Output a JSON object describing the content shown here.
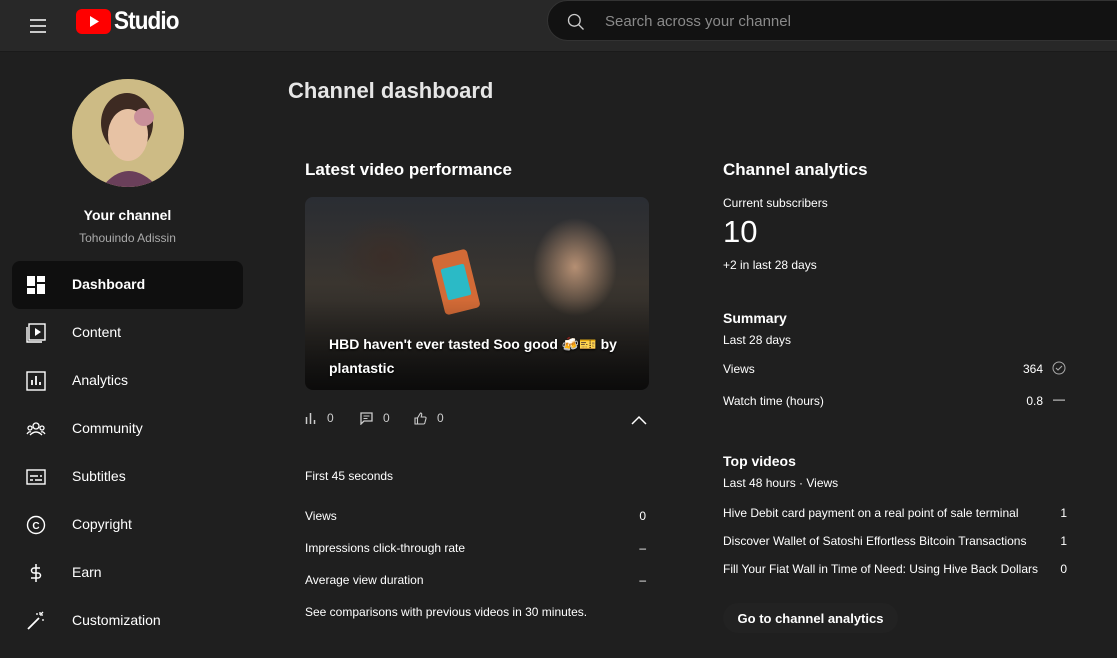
{
  "header": {
    "logo_text": "Studio",
    "search_placeholder": "Search across your channel"
  },
  "sidebar": {
    "channel_title": "Your channel",
    "channel_handle": "Tohouindo Adissin",
    "items": [
      {
        "label": "Dashboard",
        "icon": "dashboard-icon",
        "active": true
      },
      {
        "label": "Content",
        "icon": "content-icon"
      },
      {
        "label": "Analytics",
        "icon": "analytics-icon"
      },
      {
        "label": "Community",
        "icon": "community-icon"
      },
      {
        "label": "Subtitles",
        "icon": "subtitles-icon"
      },
      {
        "label": "Copyright",
        "icon": "copyright-icon"
      },
      {
        "label": "Earn",
        "icon": "earn-icon"
      },
      {
        "label": "Customization",
        "icon": "customization-icon"
      }
    ]
  },
  "main": {
    "page_title": "Channel dashboard",
    "latest": {
      "title": "Latest video performance",
      "video_title": "HBD haven't ever tasted Soo good 🍻🎫 by plantastic",
      "views_count": "0",
      "comments_count": "0",
      "likes_count": "0",
      "period": "First 45 seconds",
      "rows": [
        {
          "label": "Views",
          "value": "0"
        },
        {
          "label": "Impressions click-through rate",
          "value": "–"
        },
        {
          "label": "Average view duration",
          "value": "–"
        }
      ],
      "footnote": "See comparisons with previous videos in 30 minutes."
    },
    "analytics": {
      "title": "Channel analytics",
      "subscribers_label": "Current subscribers",
      "subscribers_value": "10",
      "subscribers_delta": "+2 in last 28 days",
      "summary_title": "Summary",
      "summary_period": "Last 28 days",
      "summary_rows": [
        {
          "label": "Views",
          "value": "364",
          "indicator": "✓"
        },
        {
          "label": "Watch time (hours)",
          "value": "0.8",
          "indicator": "—"
        }
      ],
      "top_title": "Top videos",
      "top_period": "Last 48 hours · Views",
      "top_videos": [
        {
          "title": "Hive Debit card payment on a real point of sale terminal",
          "views": "1"
        },
        {
          "title": "Discover Wallet of Satoshi Effortless Bitcoin Transactions",
          "views": "1"
        },
        {
          "title": "Fill Your Fiat Wall in Time of Need: Using Hive Back Dollars",
          "views": "0"
        }
      ],
      "button_label": "Go to channel analytics"
    }
  },
  "colors": {
    "page_bg": "#1f1f1f",
    "header_bg": "#282828",
    "active_nav_bg": "#0f0f0f",
    "logo_red": "#ff0000"
  }
}
